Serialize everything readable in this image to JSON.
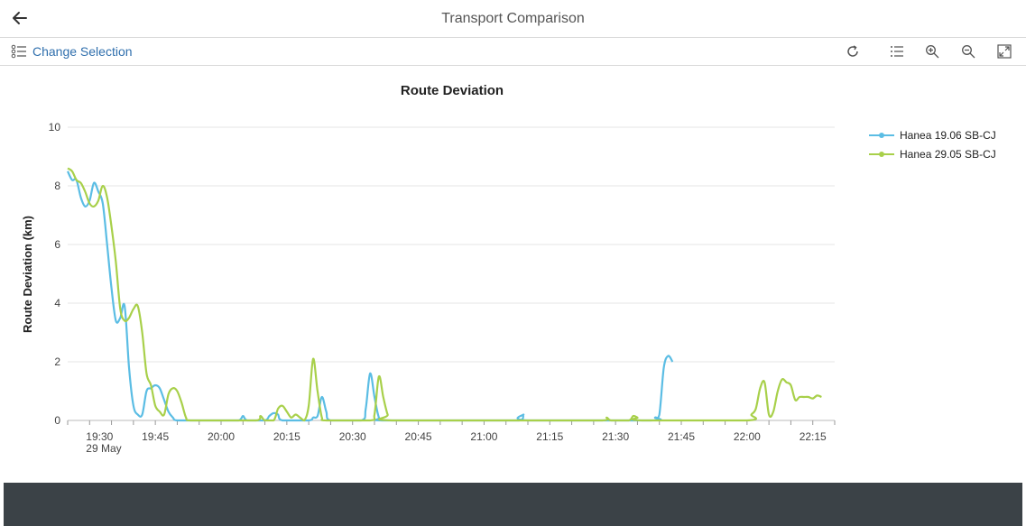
{
  "header": {
    "title": "Transport Comparison"
  },
  "toolbar": {
    "change_selection_label": "Change Selection"
  },
  "colors": {
    "series1": "#5bbde4",
    "series2": "#a8d04a",
    "link": "#2f6fad",
    "footer": "#3b4247"
  },
  "icons": [
    "back-arrow-icon",
    "list-settings-icon",
    "refresh-icon",
    "legend-list-icon",
    "zoom-in-icon",
    "zoom-out-icon",
    "fullscreen-icon"
  ],
  "chart_data": {
    "type": "line",
    "title": "Route Deviation",
    "ylabel": "Route Deviation (km)",
    "xlabel": "",
    "ylim": [
      0,
      10
    ],
    "yticks": [
      0,
      2,
      4,
      6,
      8,
      10
    ],
    "xlim": [
      "19:25",
      "22:20"
    ],
    "xticks": [
      "19:30",
      "19:45",
      "20:00",
      "20:15",
      "20:30",
      "20:45",
      "21:00",
      "21:15",
      "21:30",
      "21:45",
      "22:00",
      "22:15"
    ],
    "xtick_date": "29 May",
    "grid": true,
    "legend_position": "top-right",
    "series": [
      {
        "name": "Hanea 19.06 SB-CJ",
        "color": "#5bbde4",
        "points": [
          [
            "19:25",
            8.5
          ],
          [
            "19:26",
            8.2
          ],
          [
            "19:27",
            8.2
          ],
          [
            "19:28",
            7.6
          ],
          [
            "19:29",
            7.3
          ],
          [
            "19:30",
            7.5
          ],
          [
            "19:31",
            8.1
          ],
          [
            "19:32",
            7.8
          ],
          [
            "19:33",
            7.4
          ],
          [
            "19:34",
            6.0
          ],
          [
            "19:35",
            4.5
          ],
          [
            "19:36",
            3.4
          ],
          [
            "19:37",
            3.5
          ],
          [
            "19:38",
            3.9
          ],
          [
            "19:39",
            1.8
          ],
          [
            "19:40",
            0.5
          ],
          [
            "19:41",
            0.2
          ],
          [
            "19:42",
            0.2
          ],
          [
            "19:43",
            1.0
          ],
          [
            "19:44",
            1.1
          ],
          [
            "19:45",
            1.2
          ],
          [
            "19:46",
            1.1
          ],
          [
            "19:47",
            0.7
          ],
          [
            "19:48",
            0.3
          ],
          [
            "19:49",
            0.1
          ],
          [
            "19:50",
            0
          ],
          [
            "19:55",
            0
          ],
          [
            "20:00",
            0
          ],
          [
            "20:04",
            0
          ],
          [
            "20:05",
            0.15
          ],
          [
            "20:06",
            0
          ],
          [
            "20:10",
            0
          ],
          [
            "20:11",
            0.15
          ],
          [
            "20:12",
            0.25
          ],
          [
            "20:13",
            0.2
          ],
          [
            "20:14",
            0
          ],
          [
            "20:20",
            0
          ],
          [
            "20:21",
            0.1
          ],
          [
            "20:22",
            0.15
          ],
          [
            "20:23",
            0.8
          ],
          [
            "20:24",
            0.3
          ],
          [
            "20:25",
            0
          ],
          [
            "20:32",
            0
          ],
          [
            "20:33",
            0.4
          ],
          [
            "20:34",
            1.6
          ],
          [
            "20:35",
            0.8
          ],
          [
            "20:36",
            0.1
          ],
          [
            "20:37",
            0
          ],
          [
            "21:00",
            0
          ],
          [
            "21:08",
            0
          ],
          [
            "21:09",
            0.2
          ],
          [
            "21:10",
            0
          ],
          [
            "21:38",
            0
          ],
          [
            "21:39",
            0.1
          ],
          [
            "21:40",
            0.2
          ],
          [
            "21:41",
            1.8
          ],
          [
            "21:42",
            2.2
          ],
          [
            "21:43",
            2.0
          ]
        ]
      },
      {
        "name": "Hanea 29.05 SB-CJ",
        "color": "#a8d04a",
        "points": [
          [
            "19:25",
            8.6
          ],
          [
            "19:26",
            8.5
          ],
          [
            "19:27",
            8.2
          ],
          [
            "19:28",
            8.1
          ],
          [
            "19:29",
            7.8
          ],
          [
            "19:30",
            7.4
          ],
          [
            "19:31",
            7.3
          ],
          [
            "19:32",
            7.5
          ],
          [
            "19:33",
            8.0
          ],
          [
            "19:34",
            7.6
          ],
          [
            "19:35",
            6.6
          ],
          [
            "19:36",
            5.4
          ],
          [
            "19:37",
            3.8
          ],
          [
            "19:38",
            3.4
          ],
          [
            "19:39",
            3.5
          ],
          [
            "19:40",
            3.8
          ],
          [
            "19:41",
            3.9
          ],
          [
            "19:42",
            3.0
          ],
          [
            "19:43",
            1.6
          ],
          [
            "19:44",
            1.2
          ],
          [
            "19:45",
            0.5
          ],
          [
            "19:46",
            0.3
          ],
          [
            "19:47",
            0.2
          ],
          [
            "19:48",
            0.9
          ],
          [
            "19:49",
            1.1
          ],
          [
            "19:50",
            1.0
          ],
          [
            "19:51",
            0.6
          ],
          [
            "19:52",
            0.1
          ],
          [
            "19:53",
            0
          ],
          [
            "20:00",
            0
          ],
          [
            "20:08",
            0
          ],
          [
            "20:09",
            0.15
          ],
          [
            "20:10",
            0
          ],
          [
            "20:12",
            0
          ],
          [
            "20:13",
            0.4
          ],
          [
            "20:14",
            0.5
          ],
          [
            "20:15",
            0.3
          ],
          [
            "20:16",
            0.1
          ],
          [
            "20:17",
            0.2
          ],
          [
            "20:18",
            0.1
          ],
          [
            "20:19",
            0
          ],
          [
            "20:20",
            0.5
          ],
          [
            "20:21",
            2.1
          ],
          [
            "20:22",
            1.0
          ],
          [
            "20:23",
            0.1
          ],
          [
            "20:24",
            0
          ],
          [
            "20:34",
            0
          ],
          [
            "20:35",
            0.2
          ],
          [
            "20:36",
            1.5
          ],
          [
            "20:37",
            0.8
          ],
          [
            "20:38",
            0.2
          ],
          [
            "20:39",
            0
          ],
          [
            "21:15",
            0
          ],
          [
            "21:27",
            0
          ],
          [
            "21:28",
            0.1
          ],
          [
            "21:29",
            0
          ],
          [
            "21:33",
            0
          ],
          [
            "21:34",
            0.15
          ],
          [
            "21:35",
            0.1
          ],
          [
            "21:36",
            0
          ],
          [
            "22:00",
            0
          ],
          [
            "22:01",
            0.2
          ],
          [
            "22:02",
            0.4
          ],
          [
            "22:03",
            1.1
          ],
          [
            "22:04",
            1.3
          ],
          [
            "22:05",
            0.2
          ],
          [
            "22:06",
            0.3
          ],
          [
            "22:07",
            1.0
          ],
          [
            "22:08",
            1.4
          ],
          [
            "22:09",
            1.3
          ],
          [
            "22:10",
            1.2
          ],
          [
            "22:11",
            0.7
          ],
          [
            "22:12",
            0.8
          ],
          [
            "22:13",
            0.8
          ],
          [
            "22:14",
            0.8
          ],
          [
            "22:15",
            0.75
          ],
          [
            "22:16",
            0.85
          ],
          [
            "22:17",
            0.8
          ]
        ]
      }
    ]
  }
}
